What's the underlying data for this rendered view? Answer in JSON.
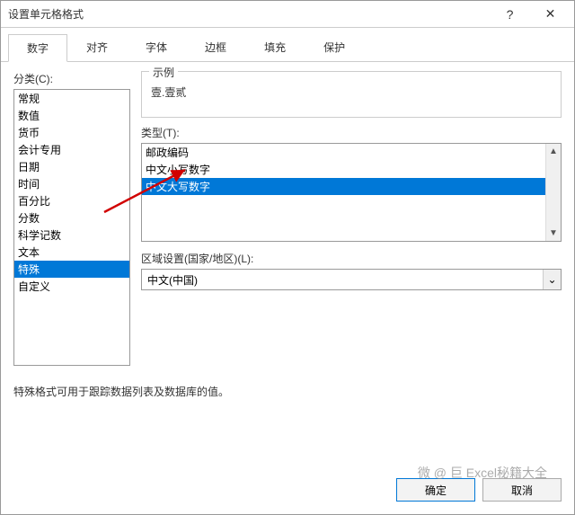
{
  "title": "设置单元格格式",
  "helpGlyph": "?",
  "closeGlyph": "✕",
  "tabs": [
    "数字",
    "对齐",
    "字体",
    "边框",
    "填充",
    "保护"
  ],
  "activeTab": 0,
  "categoryLabel": "分类(C):",
  "categories": [
    "常规",
    "数值",
    "货币",
    "会计专用",
    "日期",
    "时间",
    "百分比",
    "分数",
    "科学记数",
    "文本",
    "特殊",
    "自定义"
  ],
  "categorySelected": 10,
  "sampleGroup": "示例",
  "sampleValue": "壹.壹贰",
  "typeLabel": "类型(T):",
  "types": [
    "邮政编码",
    "中文小写数字",
    "中文大写数字"
  ],
  "typeSelected": 2,
  "scrollUpGlyph": "▲",
  "scrollDownGlyph": "▼",
  "localeLabel": "区域设置(国家/地区)(L):",
  "localeValue": "中文(中国)",
  "dropGlyph": "⌄",
  "note": "特殊格式可用于跟踪数据列表及数据库的值。",
  "okLabel": "确定",
  "cancelLabel": "取消",
  "watermark": "微 @ 巨 Excel秘籍大全"
}
